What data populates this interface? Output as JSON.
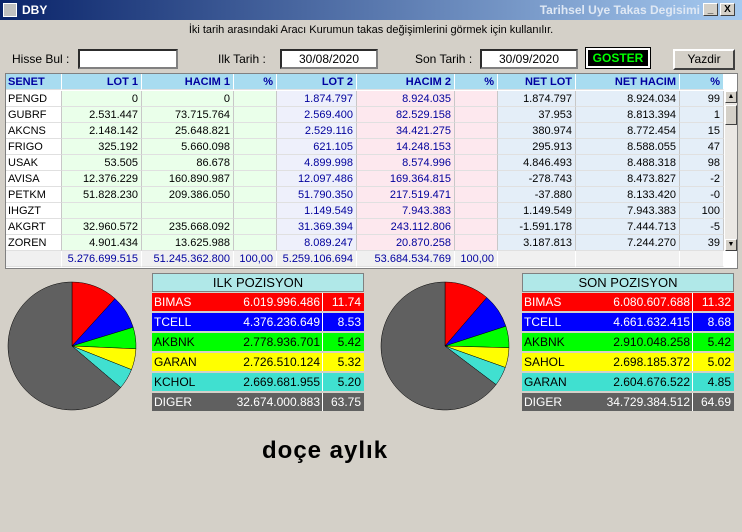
{
  "window": {
    "app_name": "DBY",
    "title": "Tarihsel Uye Takas Degisimi",
    "minimize": "_",
    "maximize": "□",
    "close": "X"
  },
  "instruction": "İki tarih arasındaki  Aracı Kurumun takas değişimlerini görmek için kullanılır.",
  "filters": {
    "hisse_bul_label": "Hisse Bul :",
    "hisse_bul_value": "",
    "ilk_tarih_label": "Ilk Tarih :",
    "ilk_tarih_value": "30/08/2020",
    "son_tarih_label": "Son Tarih :",
    "son_tarih_value": "30/09/2020",
    "goster_label": "GOSTER",
    "yazdir_label": "Yazdir"
  },
  "table": {
    "headers": [
      "SENET",
      "LOT 1",
      "HACIM 1",
      "%",
      "LOT 2",
      "HACIM 2",
      "%",
      "NET LOT",
      "NET HACIM",
      "%"
    ],
    "rows": [
      [
        "PENGD",
        "0",
        "0",
        "",
        "1.874.797",
        "8.924.035",
        "",
        "1.874.797",
        "8.924.034",
        "99"
      ],
      [
        "GUBRF",
        "2.531.447",
        "73.715.764",
        "",
        "2.569.400",
        "82.529.158",
        "",
        "37.953",
        "8.813.394",
        "1"
      ],
      [
        "AKCNS",
        "2.148.142",
        "25.648.821",
        "",
        "2.529.116",
        "34.421.275",
        "",
        "380.974",
        "8.772.454",
        "15"
      ],
      [
        "FRIGO",
        "325.192",
        "5.660.098",
        "",
        "621.105",
        "14.248.153",
        "",
        "295.913",
        "8.588.055",
        "47"
      ],
      [
        "USAK",
        "53.505",
        "86.678",
        "",
        "4.899.998",
        "8.574.996",
        "",
        "4.846.493",
        "8.488.318",
        "98"
      ],
      [
        "AVISA",
        "12.376.229",
        "160.890.987",
        "",
        "12.097.486",
        "169.364.815",
        "",
        "-278.743",
        "8.473.827",
        "-2"
      ],
      [
        "PETKM",
        "51.828.230",
        "209.386.050",
        "",
        "51.790.350",
        "217.519.471",
        "",
        "-37.880",
        "8.133.420",
        "-0"
      ],
      [
        "IHGZT",
        "",
        "",
        "",
        "1.149.549",
        "7.943.383",
        "",
        "1.149.549",
        "7.943.383",
        "100"
      ],
      [
        "AKGRT",
        "32.960.572",
        "235.668.092",
        "",
        "31.369.394",
        "243.112.806",
        "",
        "-1.591.178",
        "7.444.713",
        "-5"
      ],
      [
        "ZOREN",
        "4.901.434",
        "13.625.988",
        "",
        "8.089.247",
        "20.870.258",
        "",
        "3.187.813",
        "7.244.270",
        "39"
      ]
    ],
    "totals": [
      "",
      "5.276.699.515",
      "51.245.362.800",
      "100,00",
      "5.259.106.694",
      "53.684.534.769",
      "100,00",
      "",
      "",
      ""
    ]
  },
  "ilk_pozisyon": {
    "title": "ILK POZISYON",
    "rows": [
      {
        "name": "BIMAS",
        "value": "6.019.996.486",
        "pct": "11.74",
        "color": "#ff0000",
        "text": "#ffffff",
        "share": 11.74
      },
      {
        "name": "TCELL",
        "value": "4.376.236.649",
        "pct": "8.53",
        "color": "#0000ff",
        "text": "#ffffff",
        "share": 8.53
      },
      {
        "name": "AKBNK",
        "value": "2.778.936.701",
        "pct": "5.42",
        "color": "#00ff00",
        "text": "#000000",
        "share": 5.42
      },
      {
        "name": "GARAN",
        "value": "2.726.510.124",
        "pct": "5.32",
        "color": "#ffff00",
        "text": "#000000",
        "share": 5.32
      },
      {
        "name": "KCHOL",
        "value": "2.669.681.955",
        "pct": "5.20",
        "color": "#40e0d0",
        "text": "#000000",
        "share": 5.2
      },
      {
        "name": "DIGER",
        "value": "32.674.000.883",
        "pct": "63.75",
        "color": "#606060",
        "text": "#ffffff",
        "share": 63.75
      }
    ]
  },
  "son_pozisyon": {
    "title": "SON POZISYON",
    "rows": [
      {
        "name": "BIMAS",
        "value": "6.080.607.688",
        "pct": "11.32",
        "color": "#ff0000",
        "text": "#ffffff",
        "share": 11.32
      },
      {
        "name": "TCELL",
        "value": "4.661.632.415",
        "pct": "8.68",
        "color": "#0000ff",
        "text": "#ffffff",
        "share": 8.68
      },
      {
        "name": "AKBNK",
        "value": "2.910.048.258",
        "pct": "5.42",
        "color": "#00ff00",
        "text": "#000000",
        "share": 5.42
      },
      {
        "name": "SAHOL",
        "value": "2.698.185.372",
        "pct": "5.02",
        "color": "#ffff00",
        "text": "#000000",
        "share": 5.02
      },
      {
        "name": "GARAN",
        "value": "2.604.676.522",
        "pct": "4.85",
        "color": "#40e0d0",
        "text": "#000000",
        "share": 4.85
      },
      {
        "name": "DIGER",
        "value": "34.729.384.512",
        "pct": "64.69",
        "color": "#606060",
        "text": "#ffffff",
        "share": 64.69
      }
    ]
  },
  "caption": "doçe aylık"
}
